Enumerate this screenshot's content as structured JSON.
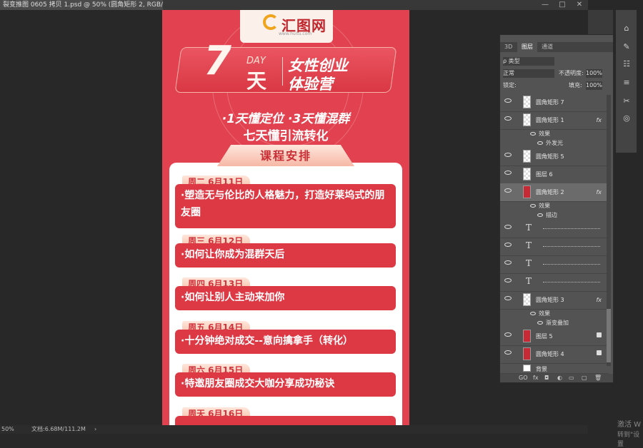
{
  "window": {
    "doc_tab": "裂变推图 0605 拷贝 1.psd @ 50% (圆角矩形 2, RGB/8#) *",
    "controls": [
      "—",
      "□",
      "✕"
    ]
  },
  "canvas": {
    "logo": {
      "text": "汇图网",
      "sub": "www.huitu.com"
    },
    "title": {
      "big": "7",
      "day": "DAY",
      "tian": "天",
      "line1": "女性创业",
      "line2": "体验营"
    },
    "subtitle1": "·1天懂定位  ·3天懂混群",
    "subtitle2": "七天懂引流转化",
    "schedule_label": "课程安排",
    "sessions": [
      {
        "day": "周二 6月11日",
        "text": "·塑造无与伦比的人格魅力，打造好莱坞式的朋友圈"
      },
      {
        "day": "周三 6月12日",
        "text": "·如何让你成为混群天后"
      },
      {
        "day": "周四 6月13日",
        "text": "·如何让别人主动来加你"
      },
      {
        "day": "周五 6月14日",
        "text": "·十分钟绝对成交--意向擒拿手（转化）"
      },
      {
        "day": "周六 6月15日",
        "text": "·特邀朋友圈成交大咖分享成功秘诀"
      },
      {
        "day": "周天 6月16日",
        "text": ""
      }
    ]
  },
  "statusbar": {
    "zoom": "50%",
    "doc": "文档:6.68M/111.2M",
    "arrow": "›"
  },
  "layers_panel": {
    "tabs": [
      "3D",
      "图层",
      "通道"
    ],
    "active_tab": "图层",
    "filter_label": "ρ 类型",
    "blend_mode": "正常",
    "opacity_label": "不透明度:",
    "opacity_value": "100%",
    "lock_label": "锁定:",
    "fill_label": "填充:",
    "fill_value": "100%",
    "layers": [
      {
        "name": "圆角矩形 7",
        "kind": "shape"
      },
      {
        "name": "圆角矩形 1",
        "kind": "shape",
        "fx": "fx",
        "effects": [
          "效果",
          "外发光"
        ]
      },
      {
        "name": "圆角矩形 5",
        "kind": "shape"
      },
      {
        "name": "图层 6",
        "kind": "pixel"
      },
      {
        "name": "圆角矩形 2",
        "kind": "shape-red",
        "fx": "fx",
        "selected": true,
        "effects": [
          "效果",
          "描边"
        ]
      },
      {
        "name": "",
        "kind": "text"
      },
      {
        "name": "",
        "kind": "text"
      },
      {
        "name": "",
        "kind": "text"
      },
      {
        "name": "",
        "kind": "text"
      },
      {
        "name": "圆角矩形 3",
        "kind": "shape",
        "fx": "fx",
        "effects": [
          "效果",
          "渐变叠加"
        ]
      },
      {
        "name": "图层 5",
        "kind": "red",
        "locked": true
      },
      {
        "name": "圆角矩形 4",
        "kind": "red",
        "locked": true
      },
      {
        "name": "背景",
        "kind": "white"
      }
    ],
    "footer_icons": [
      "GO",
      "fx",
      "◘",
      "◐",
      "▭",
      "▢",
      "🗑"
    ]
  },
  "watermark": {
    "line1": "激活 W",
    "line2": "转到\"设置"
  }
}
